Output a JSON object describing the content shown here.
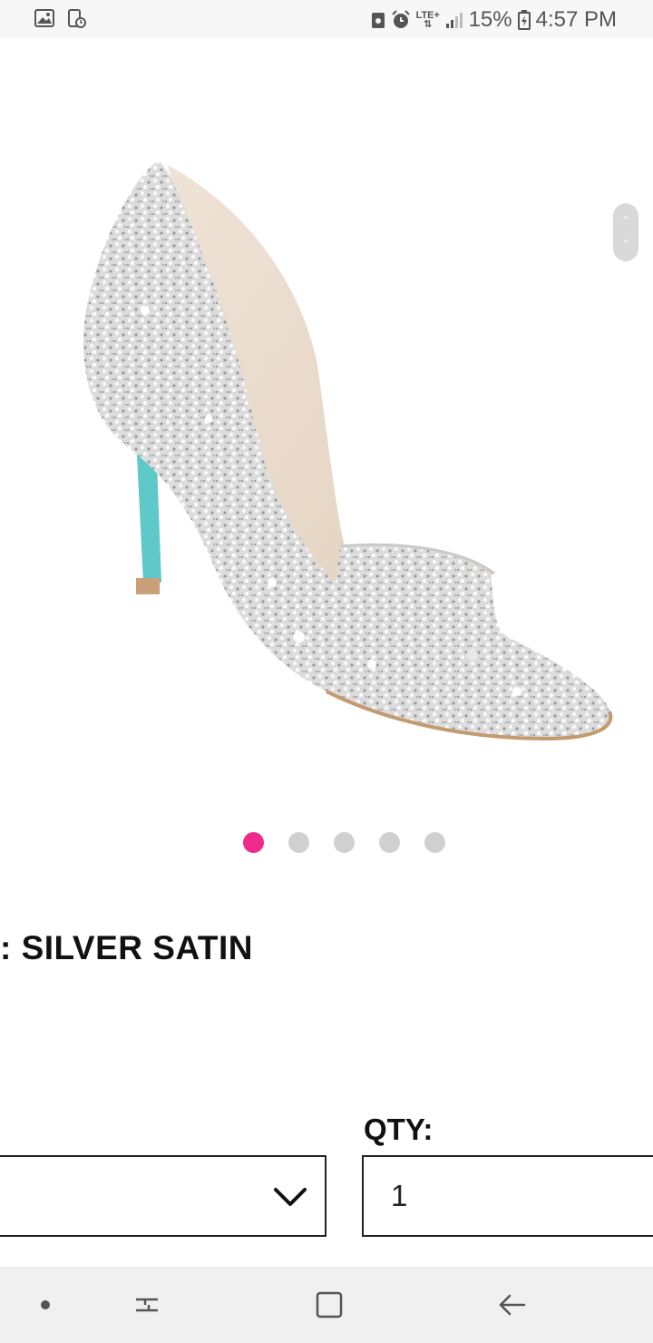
{
  "status_bar": {
    "icons_left": [
      "gallery-icon",
      "screenshot-icon"
    ],
    "icons_right": [
      "device-icon",
      "alarm-icon",
      "lte-icon",
      "signal-icon"
    ],
    "network": "LTE+",
    "battery": "15%",
    "time": "4:57 PM"
  },
  "product": {
    "image_alt": "Silver crystal embellished pointed-toe pump",
    "carousel": {
      "count": 5,
      "active_index": 0,
      "active_color": "#ef2b8b",
      "inactive_color": "#d0d0d0"
    },
    "color_label": ": SILVER SATIN"
  },
  "purchase": {
    "size_value": "",
    "qty_label": "QTY:",
    "qty_value": "1"
  },
  "nav_bar": {
    "items": [
      "dot-icon",
      "recent-apps-icon",
      "home-icon",
      "back-icon"
    ]
  }
}
